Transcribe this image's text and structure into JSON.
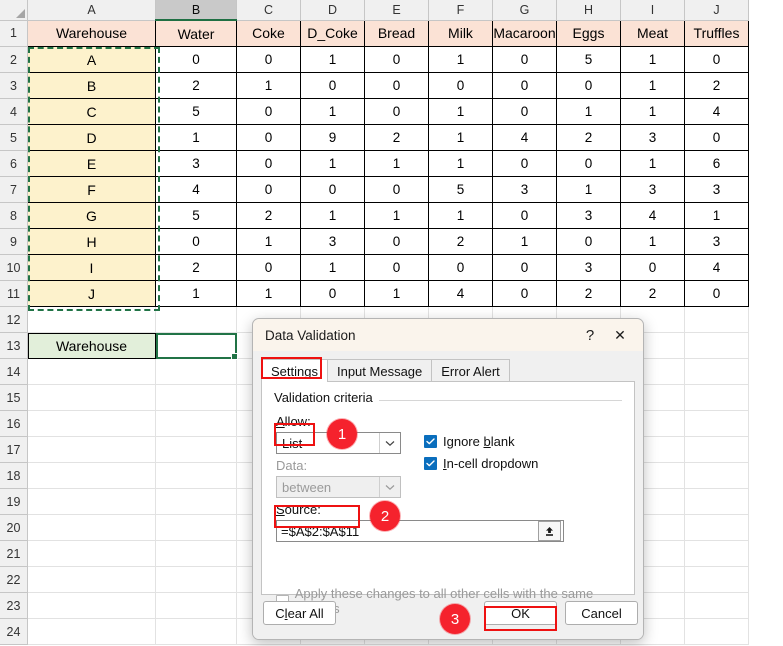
{
  "spreadsheet": {
    "column_headers": [
      "A",
      "B",
      "C",
      "D",
      "E",
      "F",
      "G",
      "H",
      "I",
      "J"
    ],
    "selected_column": "B",
    "row_numbers": [
      1,
      2,
      3,
      4,
      5,
      6,
      7,
      8,
      9,
      10,
      11,
      12,
      13,
      14,
      15,
      16,
      17,
      18,
      19,
      20,
      21,
      22,
      23,
      24
    ],
    "table_headers": [
      "Warehouse",
      "Water",
      "Coke",
      "D_Coke",
      "Bread",
      "Milk",
      "Macaroon",
      "Eggs",
      "Meat",
      "Truffles"
    ],
    "rows": [
      {
        "row": 2,
        "name": "A",
        "values": [
          0,
          0,
          1,
          0,
          1,
          0,
          5,
          1,
          0
        ]
      },
      {
        "row": 3,
        "name": "B",
        "values": [
          2,
          1,
          0,
          0,
          0,
          0,
          0,
          1,
          2
        ]
      },
      {
        "row": 4,
        "name": "C",
        "values": [
          5,
          0,
          1,
          0,
          1,
          0,
          1,
          1,
          4
        ]
      },
      {
        "row": 5,
        "name": "D",
        "values": [
          1,
          0,
          9,
          2,
          1,
          4,
          2,
          3,
          0
        ]
      },
      {
        "row": 6,
        "name": "E",
        "values": [
          3,
          0,
          1,
          1,
          1,
          0,
          0,
          1,
          6
        ]
      },
      {
        "row": 7,
        "name": "F",
        "values": [
          4,
          0,
          0,
          0,
          5,
          3,
          1,
          3,
          3
        ]
      },
      {
        "row": 8,
        "name": "G",
        "values": [
          5,
          2,
          1,
          1,
          1,
          0,
          3,
          4,
          1
        ]
      },
      {
        "row": 9,
        "name": "H",
        "values": [
          0,
          1,
          3,
          0,
          2,
          1,
          0,
          1,
          3
        ]
      },
      {
        "row": 10,
        "name": "I",
        "values": [
          2,
          0,
          1,
          0,
          0,
          0,
          3,
          0,
          4
        ]
      },
      {
        "row": 11,
        "name": "J",
        "values": [
          1,
          1,
          0,
          1,
          4,
          0,
          2,
          2,
          0
        ]
      }
    ],
    "dropdown_label_cell": "Warehouse",
    "active_cell_value": "",
    "colors": {
      "header_fill": "#fbe2d5",
      "name_fill": "#fdf2cc",
      "label_fill": "#e2efda",
      "selection_green": "#217346"
    }
  },
  "dialog": {
    "title": "Data Validation",
    "help_icon": "?",
    "close_icon": "✕",
    "tabs": [
      {
        "label": "Settings",
        "active": true
      },
      {
        "label": "Input Message",
        "active": false
      },
      {
        "label": "Error Alert",
        "active": false
      }
    ],
    "legend": "Validation criteria",
    "allow_label": "Allow:",
    "allow_value": "List",
    "data_label": "Data:",
    "data_value": "between",
    "source_label": "Source:",
    "source_value": "=$A$2:$A$11",
    "range_select_icon": "range-select-icon",
    "checkboxes": [
      {
        "label_pre": "Ignore ",
        "label_key": "b",
        "label_post": "lank",
        "checked": true
      },
      {
        "label_pre": "",
        "label_key": "I",
        "label_post": "n-cell dropdown",
        "checked": true
      }
    ],
    "apply_all_label": "Apply these changes to all other cells with the same settings",
    "apply_all_checked": false,
    "buttons": {
      "clear_all_pre": "C",
      "clear_all_key": "l",
      "clear_all_post": "ear All",
      "clear_all": "Clear All",
      "ok": "OK",
      "cancel": "Cancel"
    }
  },
  "annotations": {
    "badges": [
      "1",
      "2",
      "3"
    ],
    "highlight_color": "#ee1111",
    "badge_color": "#f5222d"
  }
}
